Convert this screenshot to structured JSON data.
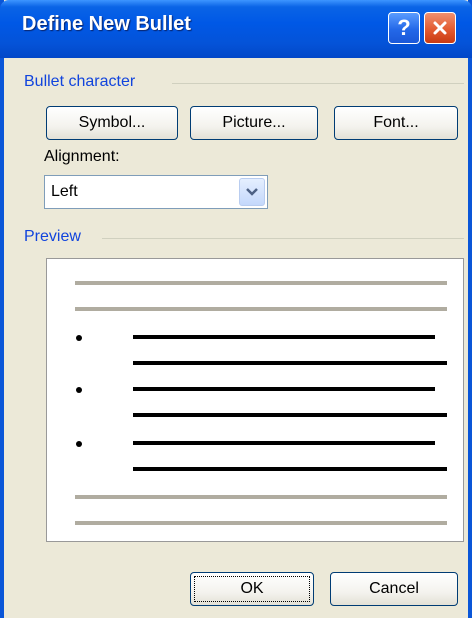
{
  "window": {
    "title": "Define New Bullet",
    "help_glyph": "?"
  },
  "bullet_character": {
    "section_label": "Bullet character",
    "buttons": {
      "symbol": "Symbol...",
      "picture": "Picture...",
      "font": "Font..."
    },
    "alignment_label": "Alignment:",
    "alignment_value": "Left"
  },
  "preview": {
    "section_label": "Preview"
  },
  "footer": {
    "ok_label": "OK",
    "cancel_label": "Cancel"
  },
  "colors": {
    "title_bar": "#0058e6",
    "section_label": "#1144dd",
    "dialog_bg": "#ece9d8",
    "close_button": "#e35b30"
  },
  "icons": [
    "help-icon",
    "close-icon",
    "chevron-down-icon"
  ]
}
